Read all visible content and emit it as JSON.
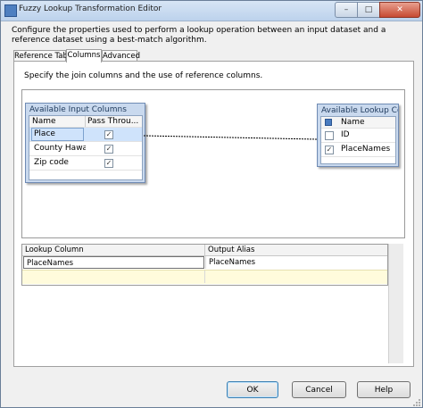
{
  "window": {
    "title": "Fuzzy Lookup Transformation Editor",
    "controls": {
      "minimize": "–",
      "maximize": "□",
      "close": "✕"
    }
  },
  "description": "Configure the properties used to perform a lookup operation between an input dataset and a reference dataset using a best-match algorithm.",
  "tabs": [
    {
      "label": "Reference Table",
      "selected": false
    },
    {
      "label": "Columns",
      "selected": true
    },
    {
      "label": "Advanced",
      "selected": false
    }
  ],
  "columns_tab": {
    "instruction": "Specify the join columns and the use of reference columns.",
    "input_columns": {
      "title": "Available Input Columns",
      "headers": [
        "Name",
        "Pass Throu..."
      ],
      "rows": [
        {
          "name": "Place",
          "pass_through": true,
          "selected": true
        },
        {
          "name": "County Hawaii",
          "pass_through": true,
          "selected": false
        },
        {
          "name": "Zip code",
          "pass_through": true,
          "selected": false
        }
      ]
    },
    "lookup_columns": {
      "title": "Available Lookup Colu...",
      "header": "Name",
      "rows": [
        {
          "name": "ID",
          "checked": false
        },
        {
          "name": "PlaceNames",
          "checked": true
        }
      ]
    },
    "mapping_grid": {
      "headers": [
        "Lookup Column",
        "Output Alias"
      ],
      "rows": [
        {
          "lookup_column": "PlaceNames",
          "output_alias": "PlaceNames"
        }
      ]
    }
  },
  "buttons": {
    "ok": "OK",
    "cancel": "Cancel",
    "help": "Help"
  },
  "colors": {
    "box_header": "#c9d9ee",
    "selected_row": "#cfe3fb",
    "new_row": "#fffbdc"
  }
}
